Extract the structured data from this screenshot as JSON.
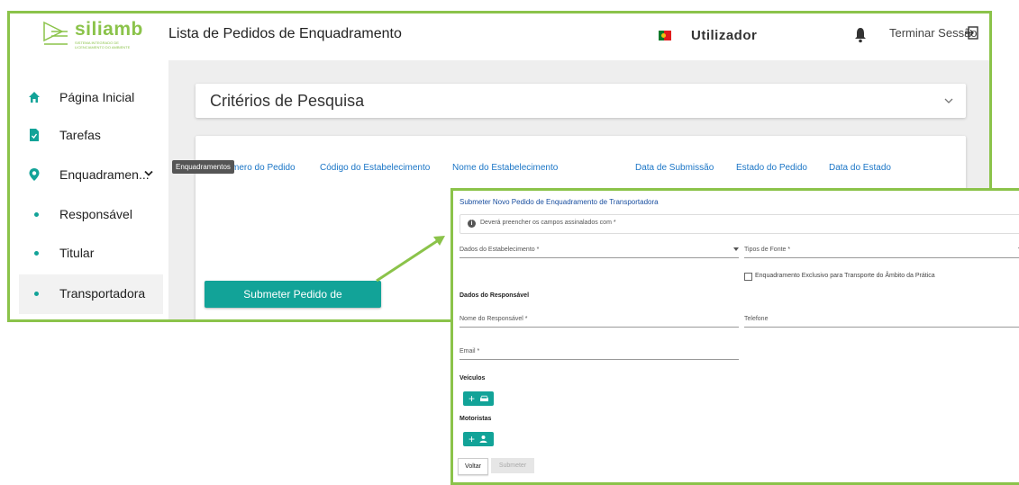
{
  "header": {
    "brand": "siliamb",
    "tagline": "SISTEMA INTEGRADO DE LICENCIAMENTO DO AMBIENTE",
    "page_title": "Lista de Pedidos de Enquadramento",
    "user_label": "Utilizador",
    "logout_label": "Terminar Sessão"
  },
  "sidebar": {
    "items": [
      {
        "label": "Página Inicial",
        "icon": "home-icon"
      },
      {
        "label": "Tarefas",
        "icon": "task-file-icon"
      },
      {
        "label": "Enquadramen...",
        "icon": "location-pin-icon"
      },
      {
        "label": "Responsável",
        "icon": "bullet-icon"
      },
      {
        "label": "Titular",
        "icon": "bullet-icon"
      },
      {
        "label": "Transportadora",
        "icon": "bullet-icon"
      }
    ],
    "tooltip": "Enquadramentos"
  },
  "main": {
    "criteria_title": "Critérios de Pesquisa",
    "columns": [
      "Número do Pedido",
      "Código do Estabelecimento",
      "Nome do Estabelecimento",
      "Data de Submissão",
      "Estado do Pedido",
      "Data do Estado"
    ],
    "column_0_visible": "mero do Pedido",
    "submit_button": "Submeter Pedido de Enquadramento"
  },
  "modal": {
    "title": "Submeter Novo Pedido de Enquadramento de Transportadora",
    "info": "Deverá preencher os campos assinalados com *",
    "establishment_label": "Dados do Estabelecimento *",
    "source_types_label": "Tipos de Fonte *",
    "exclusive_checkbox_label": "Enquadramento Exclusivo para Transporte do Âmbito da Prática",
    "responsible_section": "Dados do Responsável",
    "responsible_name_label": "Nome do Responsável *",
    "phone_label": "Telefone",
    "email_label": "Email *",
    "vehicles_section": "Veículos",
    "drivers_section": "Motoristas",
    "back_button": "Voltar",
    "submit_button": "Submeter"
  },
  "colors": {
    "accent_green": "#8bc34a",
    "teal": "#12a398",
    "link_blue": "#1a75c6"
  }
}
